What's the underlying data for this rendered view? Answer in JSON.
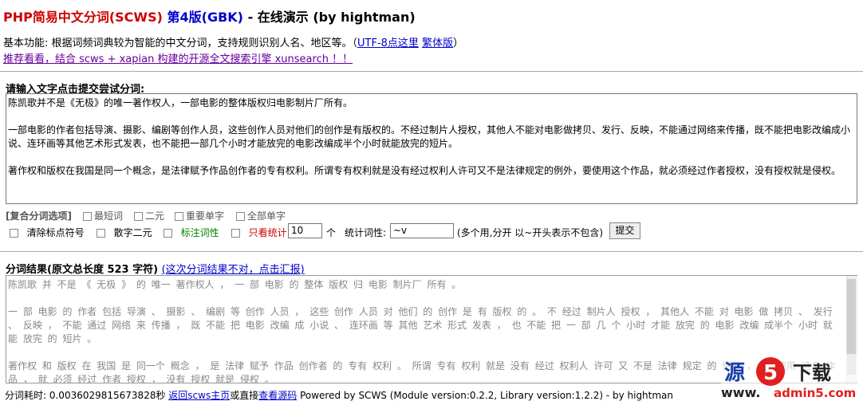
{
  "header": {
    "title_part1": "PHP简易中文分词(SCWS)",
    "title_part2": "第4版(GBK)",
    "title_part3": "- 在线演示 (by hightman)"
  },
  "intro": {
    "text": "基本功能: 根据词频词典较为智能的中文分词，支持规则识别人名、地区等。（",
    "link1": "UTF-8点这里",
    "link2": "繁体版",
    "close": "）"
  },
  "promo": {
    "text": "推荐看看，结合 scws + xapian 构建的开源全文搜索引擎 xunsearch ！！"
  },
  "form": {
    "prompt": "请输入文字点击提交尝试分词:",
    "input_text": "陈凯歌并不是《无极》的唯一著作权人，一部电影的整体版权归电影制片厂所有。\n\n一部电影的作者包括导演、摄影、编剧等创作人员，这些创作人员对他们的创作是有版权的。不经过制片人授权，其他人不能对电影做拷贝、发行、反映，不能通过网络来传播，既不能把电影改编成小说、连环画等其他艺术形式发表，也不能把一部几个小时才能放完的电影改编成半个小时就能放完的短片。\n\n著作权和版权在我国是同一个概念，是法律赋予作品创作者的专有权利。所谓专有权利就是没有经过权利人许可又不是法律规定的例外，要使用这个作品，就必须经过作者授权，没有授权就是侵权。",
    "options_title": "[复合分词选项]",
    "opt_shortest": "最短词",
    "opt_duality": "二元",
    "opt_major_single": "重要单字",
    "opt_all_single": "全部单字",
    "opt_strip_punct": "清除标点符号",
    "opt_scatter_duality": "散字二元",
    "opt_attr": "标注词性",
    "opt_stats": "只看统计",
    "limit_value": "10",
    "limit_unit": "个",
    "attr_label": "统计词性:",
    "attr_value": "~v",
    "attr_hint": "(多个用,分开 以~开头表示不包含)",
    "submit": "提交",
    "colors": {
      "attr": "#008000",
      "stats": "#cc0000"
    }
  },
  "result": {
    "label": "分词结果(原文总长度 523 字符)",
    "report_link": "(这次分词结果不对，点击汇报)",
    "text": "陈凯歌 并 不是 《 无极 》 的 唯一 著作权人 ， 一 部 电影 的 整体 版权 归 电影 制片厂 所有 。\n\n一 部 电影 的 作者 包括 导演 、 摄影 、 编剧 等 创作 人员 ， 这些 创作 人员 对 他们 的 创作 是 有 版权 的 。 不 经过 制片人 授权 ， 其他人 不能 对 电影 做 拷贝 、 发行 、 反映 ， 不能 通过 网络 来 传播 ， 既 不能 把 电影 改编 成 小说 、 连环画 等 其他 艺术 形式 发表 ， 也 不能 把 一 部 几 个 小时 才能 放完 的 电影 改编 成半个 小时 就 能 放完 的 短片 。\n\n著作权 和 版权 在 我国 是 同一个 概念 ， 是 法律 赋予 作品 创作者 的 专有 权利 。 所谓 专有 权利 就是 没有 经过 权利人 许可 又 不是 法律 规定 的 例外 ， 要 使用 这个 作品 ， 就 必须 经过 作者 授权 ， 没有 授权 就是 侵权 。"
  },
  "footer": {
    "time": "分词耗时: 0.0036029815673828秒",
    "home_link": "返回scws主页",
    "or_text": "或直接",
    "source_link": "查看源码",
    "powered": "Powered by SCWS (Module version:0.2.2, Library version:1.2.2) - by hightman"
  },
  "watermark": {
    "text1": "源",
    "text2": "下载",
    "url": "admin5.com",
    "url2": "www."
  }
}
